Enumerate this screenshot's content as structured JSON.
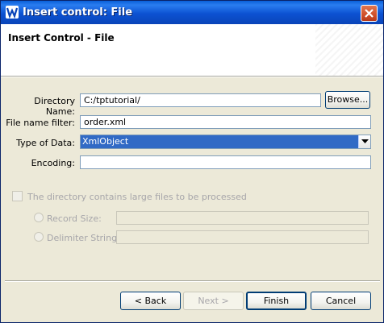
{
  "window": {
    "title": "Insert control: File",
    "icon": "wizard-app-icon",
    "close_icon": "close-icon"
  },
  "header": {
    "title": "Insert Control - File"
  },
  "form": {
    "directory_label": "Directory Name:",
    "directory_value": "C:/tptutorial/",
    "browse_label": "Browse...",
    "filter_label": "File name filter:",
    "filter_value": "order.xml",
    "type_label": "Type of Data:",
    "type_value": "XmlObject",
    "encoding_label": "Encoding:",
    "encoding_value": ""
  },
  "large_files": {
    "checkbox_label": "The directory contains large files to be processed",
    "checked": false,
    "record_size_label": "Record Size:",
    "delimiter_label": "Delimiter String:"
  },
  "buttons": {
    "back": "< Back",
    "next": "Next >",
    "finish": "Finish",
    "cancel": "Cancel"
  },
  "colors": {
    "titlebar": "#0c52d2",
    "selection": "#316ac5",
    "dialog_bg": "#ece9d8"
  }
}
